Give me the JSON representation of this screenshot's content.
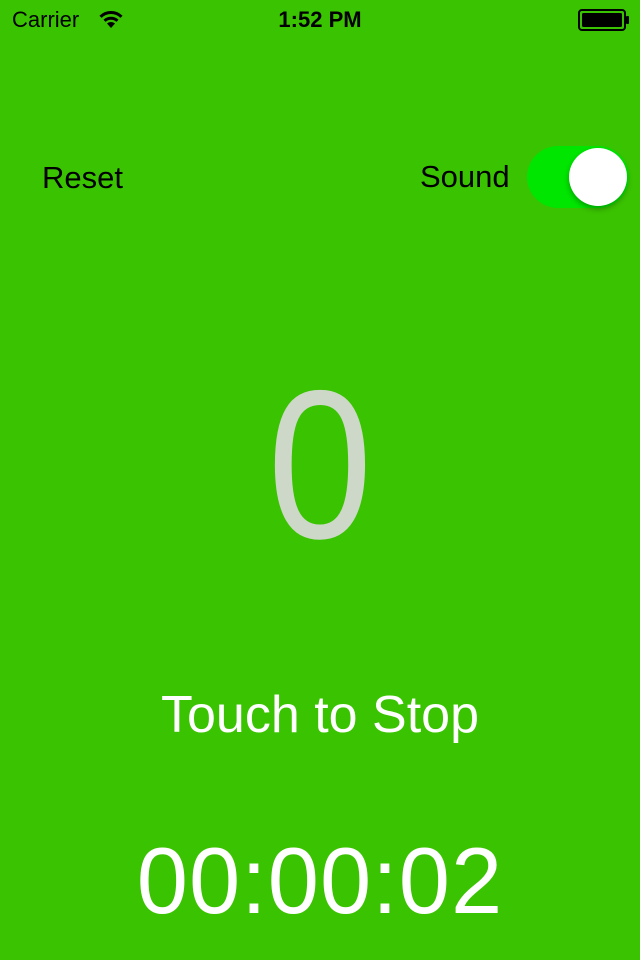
{
  "colors": {
    "background": "#3ac300",
    "toggle_on": "#00e600",
    "counter_text": "#cdd8c8",
    "label_text": "#ffffff",
    "status_text": "#000000"
  },
  "status_bar": {
    "carrier": "Carrier",
    "time": "1:52 PM",
    "wifi_icon": "wifi-icon",
    "battery_icon": "battery-icon"
  },
  "controls": {
    "reset_label": "Reset",
    "sound_label": "Sound",
    "sound_on": true
  },
  "counter": {
    "value": "0"
  },
  "prompt": {
    "label": "Touch to Stop"
  },
  "timer": {
    "value": "00:00:02"
  }
}
